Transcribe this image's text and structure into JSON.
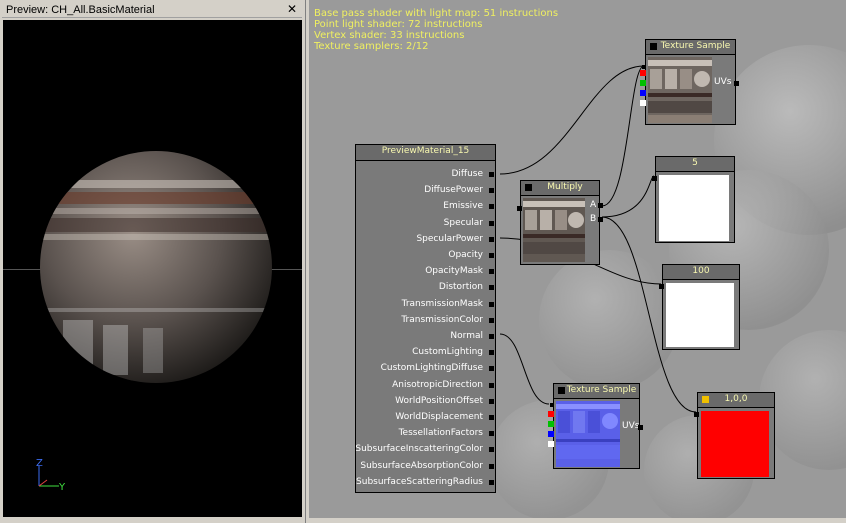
{
  "preview": {
    "title": "Preview: CH_All.BasicMaterial",
    "close_glyph": "✕",
    "axis_z": "Z",
    "axis_y": "Y"
  },
  "stats": [
    "Base pass shader with light map: 51 instructions",
    "Point light shader: 72 instructions",
    "Vertex shader: 33 instructions",
    "Texture samplers: 2/12"
  ],
  "material_node": {
    "title": "PreviewMaterial_15",
    "inputs": [
      "Diffuse",
      "DiffusePower",
      "Emissive",
      "Specular",
      "SpecularPower",
      "Opacity",
      "OpacityMask",
      "Distortion",
      "TransmissionMask",
      "TransmissionColor",
      "Normal",
      "CustomLighting",
      "CustomLightingDiffuse",
      "AnisotropicDirection",
      "WorldPositionOffset",
      "WorldDisplacement",
      "TessellationFactors",
      "SubsurfaceInscatteringColor",
      "SubsurfaceAbsorptionColor",
      "SubsurfaceScatteringRadius"
    ]
  },
  "texture_sample_top": {
    "title": "Texture Sample",
    "output_label": "UVs"
  },
  "texture_sample_bottom": {
    "title": "Texture Sample",
    "output_label": "UVs"
  },
  "multiply_node": {
    "title": "Multiply",
    "input_a": "A",
    "input_b": "B"
  },
  "constant_5": {
    "title": "5"
  },
  "constant_100": {
    "title": "100"
  },
  "vector_node": {
    "title": "1,0,0",
    "color": "#ff0000",
    "handle_color": "#f0c000"
  },
  "colors": {
    "channel_red": "#ff0000",
    "channel_green": "#00c000",
    "channel_blue": "#0000ff",
    "channel_alpha": "#ffffff",
    "stats_text": "#f0f060",
    "node_title_text": "#f8f8b0"
  }
}
